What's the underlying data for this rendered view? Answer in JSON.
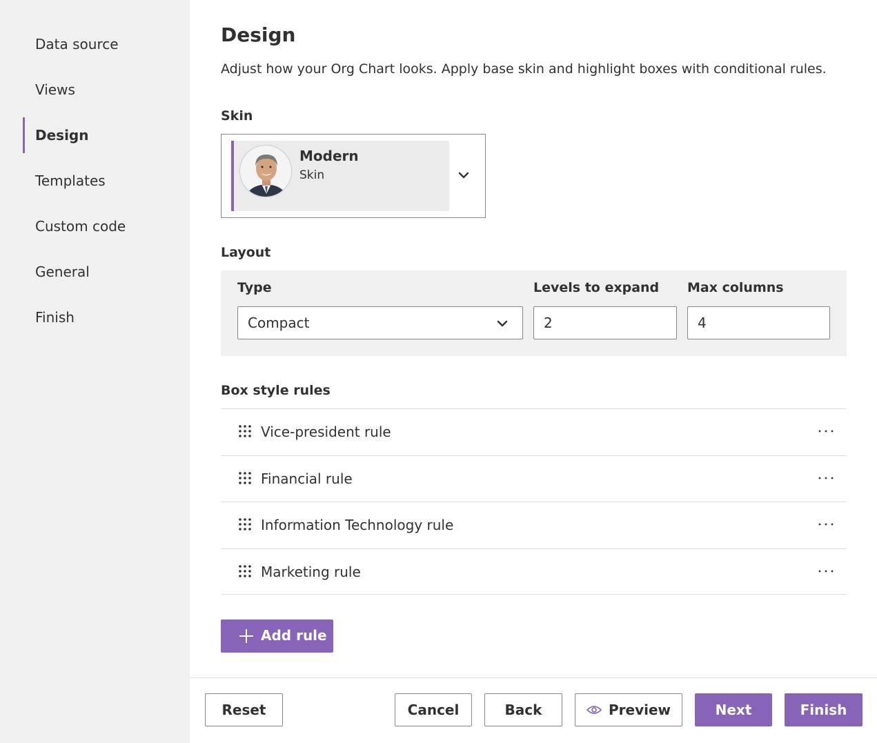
{
  "sidebar": {
    "items": [
      {
        "label": "Data source"
      },
      {
        "label": "Views"
      },
      {
        "label": "Design",
        "active": true
      },
      {
        "label": "Templates"
      },
      {
        "label": "Custom code"
      },
      {
        "label": "General"
      },
      {
        "label": "Finish"
      }
    ]
  },
  "header": {
    "title": "Design",
    "description": "Adjust how your Org Chart looks. Apply base skin and highlight boxes with conditional rules."
  },
  "skin": {
    "label": "Skin",
    "selected_name": "Modern",
    "selected_sub": "Skin",
    "icon": "chevron-down-icon"
  },
  "layout": {
    "label": "Layout",
    "type_label": "Type",
    "type_value": "Compact",
    "levels_label": "Levels to expand",
    "levels_value": "2",
    "max_columns_label": "Max columns",
    "max_columns_value": "4"
  },
  "rules": {
    "label": "Box style rules",
    "items": [
      {
        "label": "Vice-president rule"
      },
      {
        "label": "Financial rule"
      },
      {
        "label": "Information Technology rule"
      },
      {
        "label": "Marketing rule"
      }
    ],
    "add_label": "Add rule"
  },
  "footer": {
    "reset": "Reset",
    "cancel": "Cancel",
    "back": "Back",
    "preview": "Preview",
    "next": "Next",
    "finish": "Finish"
  },
  "colors": {
    "accent": "#8764b8",
    "sidebar_bg": "#f0f0f0",
    "text": "#323130"
  }
}
